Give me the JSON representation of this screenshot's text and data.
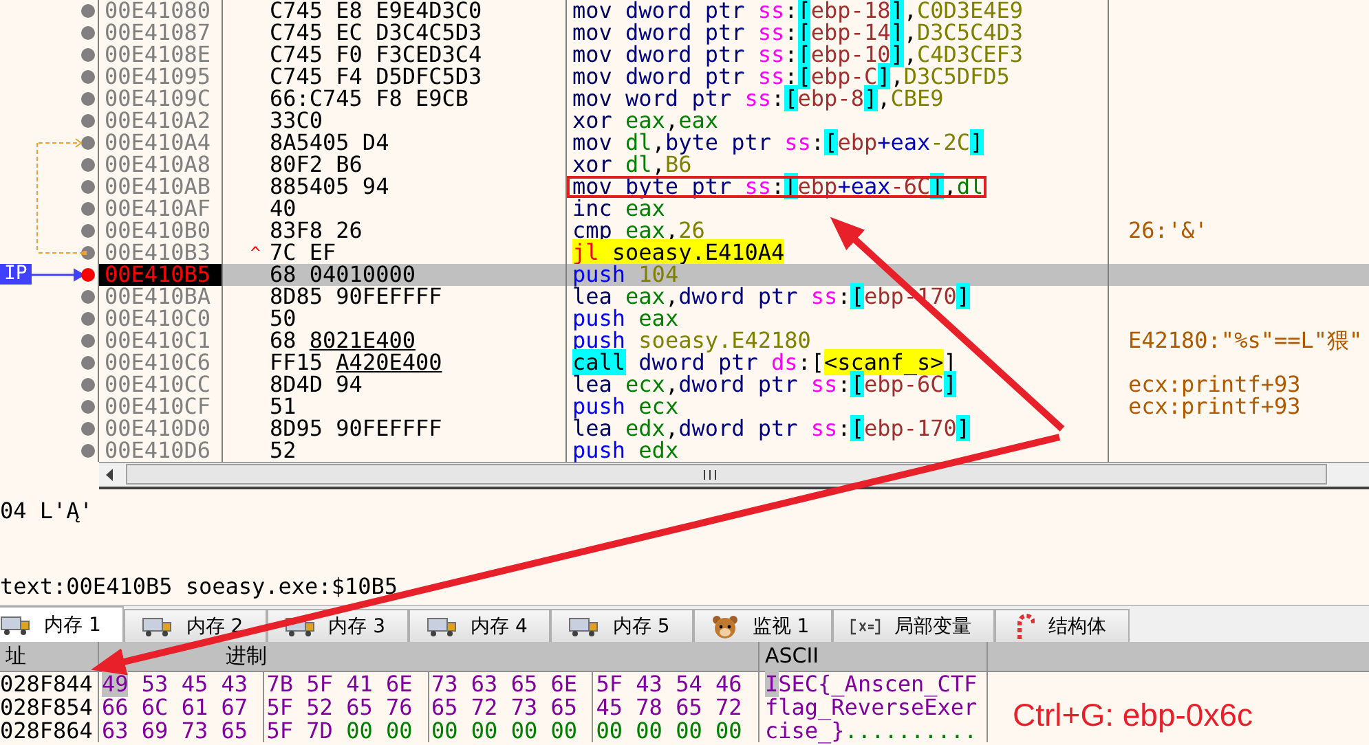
{
  "disassembly": {
    "rows": [
      {
        "address": "00E41080",
        "bytes": "C745 E8 E9E4D3C0",
        "selected": false,
        "boxed": false,
        "jump_target": false,
        "jump_source": false,
        "instruction": [
          {
            "kind": "mn",
            "text": "mov "
          },
          {
            "kind": "sz",
            "text": "dword ptr "
          },
          {
            "kind": "sg",
            "text": "ss"
          },
          {
            "kind": "p",
            "text": ":"
          },
          {
            "kind": "br",
            "text": "["
          },
          {
            "kind": "bp",
            "text": "ebp-18"
          },
          {
            "kind": "br",
            "text": "]"
          },
          {
            "kind": "p",
            "text": ","
          },
          {
            "kind": "nm",
            "text": "C0D3E4E9"
          }
        ]
      },
      {
        "address": "00E41087",
        "bytes": "C745 EC D3C4C5D3",
        "selected": false,
        "boxed": false,
        "jump_target": false,
        "jump_source": false,
        "instruction": [
          {
            "kind": "mn",
            "text": "mov "
          },
          {
            "kind": "sz",
            "text": "dword ptr "
          },
          {
            "kind": "sg",
            "text": "ss"
          },
          {
            "kind": "p",
            "text": ":"
          },
          {
            "kind": "br",
            "text": "["
          },
          {
            "kind": "bp",
            "text": "ebp-14"
          },
          {
            "kind": "br",
            "text": "]"
          },
          {
            "kind": "p",
            "text": ","
          },
          {
            "kind": "nm",
            "text": "D3C5C4D3"
          }
        ]
      },
      {
        "address": "00E4108E",
        "bytes": "C745 F0 F3CED3C4",
        "selected": false,
        "boxed": false,
        "jump_target": false,
        "jump_source": false,
        "instruction": [
          {
            "kind": "mn",
            "text": "mov "
          },
          {
            "kind": "sz",
            "text": "dword ptr "
          },
          {
            "kind": "sg",
            "text": "ss"
          },
          {
            "kind": "p",
            "text": ":"
          },
          {
            "kind": "br",
            "text": "["
          },
          {
            "kind": "bp",
            "text": "ebp-10"
          },
          {
            "kind": "br",
            "text": "]"
          },
          {
            "kind": "p",
            "text": ","
          },
          {
            "kind": "nm",
            "text": "C4D3CEF3"
          }
        ]
      },
      {
        "address": "00E41095",
        "bytes": "C745 F4 D5DFC5D3",
        "selected": false,
        "boxed": false,
        "jump_target": false,
        "jump_source": false,
        "instruction": [
          {
            "kind": "mn",
            "text": "mov "
          },
          {
            "kind": "sz",
            "text": "dword ptr "
          },
          {
            "kind": "sg",
            "text": "ss"
          },
          {
            "kind": "p",
            "text": ":"
          },
          {
            "kind": "br",
            "text": "["
          },
          {
            "kind": "bp",
            "text": "ebp-C"
          },
          {
            "kind": "br",
            "text": "]"
          },
          {
            "kind": "p",
            "text": ","
          },
          {
            "kind": "nm",
            "text": "D3C5DFD5"
          }
        ]
      },
      {
        "address": "00E4109C",
        "bytes": "66:C745 F8 E9CB",
        "selected": false,
        "boxed": false,
        "jump_target": false,
        "jump_source": false,
        "instruction": [
          {
            "kind": "mn",
            "text": "mov "
          },
          {
            "kind": "sz",
            "text": "word ptr "
          },
          {
            "kind": "sg",
            "text": "ss"
          },
          {
            "kind": "p",
            "text": ":"
          },
          {
            "kind": "br",
            "text": "["
          },
          {
            "kind": "bp",
            "text": "ebp-8"
          },
          {
            "kind": "br",
            "text": "]"
          },
          {
            "kind": "p",
            "text": ","
          },
          {
            "kind": "nm",
            "text": "CBE9"
          }
        ]
      },
      {
        "address": "00E410A2",
        "bytes": "33C0",
        "selected": false,
        "boxed": false,
        "jump_target": false,
        "jump_source": false,
        "instruction": [
          {
            "kind": "mn",
            "text": "xor "
          },
          {
            "kind": "rg",
            "text": "eax"
          },
          {
            "kind": "p",
            "text": ","
          },
          {
            "kind": "rg",
            "text": "eax"
          }
        ]
      },
      {
        "address": "00E410A4",
        "bytes": "8A5405 D4",
        "selected": false,
        "boxed": false,
        "jump_target": true,
        "jump_source": false,
        "instruction": [
          {
            "kind": "mn",
            "text": "mov "
          },
          {
            "kind": "rg",
            "text": "dl"
          },
          {
            "kind": "p",
            "text": ","
          },
          {
            "kind": "sz",
            "text": "byte ptr "
          },
          {
            "kind": "sg",
            "text": "ss"
          },
          {
            "kind": "p",
            "text": ":"
          },
          {
            "kind": "br",
            "text": "["
          },
          {
            "kind": "bp",
            "text": "ebp"
          },
          {
            "kind": "ix",
            "text": "+eax"
          },
          {
            "kind": "nm",
            "text": "-2C"
          },
          {
            "kind": "br",
            "text": "]"
          }
        ]
      },
      {
        "address": "00E410A8",
        "bytes": "80F2 B6",
        "selected": false,
        "boxed": false,
        "jump_target": false,
        "jump_source": false,
        "instruction": [
          {
            "kind": "mn",
            "text": "xor "
          },
          {
            "kind": "rg",
            "text": "dl"
          },
          {
            "kind": "p",
            "text": ","
          },
          {
            "kind": "nm",
            "text": "B6"
          }
        ]
      },
      {
        "address": "00E410AB",
        "bytes": "885405 94",
        "selected": false,
        "boxed": true,
        "jump_target": false,
        "jump_source": false,
        "instruction": [
          {
            "kind": "mn",
            "text": "mov "
          },
          {
            "kind": "sz",
            "text": "byte ptr "
          },
          {
            "kind": "sg",
            "text": "ss"
          },
          {
            "kind": "p",
            "text": ":"
          },
          {
            "kind": "br",
            "text": "["
          },
          {
            "kind": "bp",
            "text": "ebp"
          },
          {
            "kind": "ix",
            "text": "+eax"
          },
          {
            "kind": "bp",
            "text": "-6C"
          },
          {
            "kind": "br",
            "text": "]"
          },
          {
            "kind": "p",
            "text": ","
          },
          {
            "kind": "rg",
            "text": "dl"
          }
        ]
      },
      {
        "address": "00E410AF",
        "bytes": "40",
        "selected": false,
        "boxed": false,
        "jump_target": false,
        "jump_source": false,
        "instruction": [
          {
            "kind": "mn",
            "text": "inc "
          },
          {
            "kind": "rg",
            "text": "eax"
          }
        ]
      },
      {
        "address": "00E410B0",
        "bytes": "83F8 26",
        "selected": false,
        "boxed": false,
        "jump_target": false,
        "jump_source": false,
        "comment": "26:'&'",
        "instruction": [
          {
            "kind": "mn",
            "text": "cmp "
          },
          {
            "kind": "rg",
            "text": "eax"
          },
          {
            "kind": "p",
            "text": ","
          },
          {
            "kind": "nm",
            "text": "26"
          }
        ]
      },
      {
        "address": "00E410B3",
        "bytes": "7C EF",
        "jump_mark": "^",
        "selected": false,
        "boxed": false,
        "jump_target": false,
        "jump_source": true,
        "instruction": [
          {
            "kind": "jl",
            "text": "jl"
          },
          {
            "kind": "lb",
            "text": " soeasy.E410A4"
          }
        ]
      },
      {
        "address": "00E410B5",
        "bytes": "68 04010000",
        "ip_label": "IP",
        "selected": true,
        "boxed": false,
        "jump_target": false,
        "jump_source": false,
        "instruction": [
          {
            "kind": "ps",
            "text": "push "
          },
          {
            "kind": "nm",
            "text": "104"
          }
        ]
      },
      {
        "address": "00E410BA",
        "bytes": "8D85 90FEFFFF",
        "selected": false,
        "boxed": false,
        "jump_target": false,
        "jump_source": false,
        "instruction": [
          {
            "kind": "mn",
            "text": "lea "
          },
          {
            "kind": "rg",
            "text": "eax"
          },
          {
            "kind": "p",
            "text": ","
          },
          {
            "kind": "sz",
            "text": "dword ptr "
          },
          {
            "kind": "sg",
            "text": "ss"
          },
          {
            "kind": "p",
            "text": ":"
          },
          {
            "kind": "br",
            "text": "["
          },
          {
            "kind": "bp",
            "text": "ebp-170"
          },
          {
            "kind": "br",
            "text": "]"
          }
        ]
      },
      {
        "address": "00E410C0",
        "bytes": "50",
        "selected": false,
        "boxed": false,
        "jump_target": false,
        "jump_source": false,
        "instruction": [
          {
            "kind": "ps",
            "text": "push "
          },
          {
            "kind": "rg",
            "text": "eax"
          }
        ]
      },
      {
        "address": "00E410C1",
        "bytes": "68",
        "bytes_ref": "8021E400",
        "selected": false,
        "boxed": false,
        "jump_target": false,
        "jump_source": false,
        "comment": "E42180:\"%s\"==L\"猥\"",
        "instruction": [
          {
            "kind": "ps",
            "text": "push "
          },
          {
            "kind": "sy",
            "text": "soeasy.E42180"
          }
        ]
      },
      {
        "address": "00E410C6",
        "bytes": "FF15",
        "bytes_ref": "A420E400",
        "selected": false,
        "boxed": false,
        "jump_target": false,
        "jump_source": false,
        "instruction": [
          {
            "kind": "cl",
            "text": "call"
          },
          {
            "kind": "sz",
            "text": " dword ptr "
          },
          {
            "kind": "sg",
            "text": "ds"
          },
          {
            "kind": "p",
            "text": ":["
          },
          {
            "kind": "ap",
            "text": "<scanf_s>"
          },
          {
            "kind": "p",
            "text": "]"
          }
        ]
      },
      {
        "address": "00E410CC",
        "bytes": "8D4D 94",
        "selected": false,
        "boxed": false,
        "jump_target": false,
        "jump_source": false,
        "comment": "ecx:printf+93",
        "instruction": [
          {
            "kind": "mn",
            "text": "lea "
          },
          {
            "kind": "rg",
            "text": "ecx"
          },
          {
            "kind": "p",
            "text": ","
          },
          {
            "kind": "sz",
            "text": "dword ptr "
          },
          {
            "kind": "sg",
            "text": "ss"
          },
          {
            "kind": "p",
            "text": ":"
          },
          {
            "kind": "br",
            "text": "["
          },
          {
            "kind": "bp",
            "text": "ebp-6C"
          },
          {
            "kind": "br",
            "text": "]"
          }
        ]
      },
      {
        "address": "00E410CF",
        "bytes": "51",
        "selected": false,
        "boxed": false,
        "jump_target": false,
        "jump_source": false,
        "comment": "ecx:printf+93",
        "instruction": [
          {
            "kind": "ps",
            "text": "push "
          },
          {
            "kind": "rg",
            "text": "ecx"
          }
        ]
      },
      {
        "address": "00E410D0",
        "bytes": "8D95 90FEFFFF",
        "selected": false,
        "boxed": false,
        "jump_target": false,
        "jump_source": false,
        "instruction": [
          {
            "kind": "mn",
            "text": "lea "
          },
          {
            "kind": "rg",
            "text": "edx"
          },
          {
            "kind": "p",
            "text": ","
          },
          {
            "kind": "sz",
            "text": "dword ptr "
          },
          {
            "kind": "sg",
            "text": "ss"
          },
          {
            "kind": "p",
            "text": ":"
          },
          {
            "kind": "br",
            "text": "["
          },
          {
            "kind": "bp",
            "text": "ebp-170"
          },
          {
            "kind": "br",
            "text": "]"
          }
        ]
      },
      {
        "address": "00E410D6",
        "bytes": "52",
        "selected": false,
        "boxed": false,
        "jump_target": false,
        "jump_source": false,
        "instruction": [
          {
            "kind": "ps",
            "text": "push "
          },
          {
            "kind": "rg",
            "text": "edx"
          }
        ]
      }
    ]
  },
  "info_panel": {
    "lines": [
      "04 L'Ą'",
      "text:00E410B5 soeasy.exe:$10B5"
    ]
  },
  "tabs": [
    {
      "label": "内存 1",
      "kind": "memory",
      "selected": true
    },
    {
      "label": "内存 2",
      "kind": "memory",
      "selected": false
    },
    {
      "label": "内存 3",
      "kind": "memory",
      "selected": false
    },
    {
      "label": "内存 4",
      "kind": "memory",
      "selected": false
    },
    {
      "label": "内存 5",
      "kind": "memory",
      "selected": false
    },
    {
      "label": "监视 1",
      "kind": "watch",
      "selected": false
    },
    {
      "label": "局部变量",
      "kind": "locals",
      "selected": false
    },
    {
      "label": "结构体",
      "kind": "struct",
      "selected": false
    }
  ],
  "dump": {
    "columns": [
      "址",
      "进制",
      "ASCII"
    ],
    "rows": [
      {
        "address": "028F844",
        "cursor_on_first": true,
        "bytes": [
          "49",
          "53",
          "45",
          "43",
          "7B",
          "5F",
          "41",
          "6E",
          "73",
          "63",
          "65",
          "6E",
          "5F",
          "43",
          "54",
          "46"
        ],
        "ascii": "ISEC{_Anscen_CTF"
      },
      {
        "address": "028F854",
        "cursor_on_first": false,
        "bytes": [
          "66",
          "6C",
          "61",
          "67",
          "5F",
          "52",
          "65",
          "76",
          "65",
          "72",
          "73",
          "65",
          "45",
          "78",
          "65",
          "72"
        ],
        "ascii": "flag_ReverseExer"
      },
      {
        "address": "028F864",
        "cursor_on_first": false,
        "bytes": [
          "63",
          "69",
          "73",
          "65",
          "5F",
          "7D",
          "00",
          "00",
          "00",
          "00",
          "00",
          "00",
          "00",
          "00",
          "00",
          "00"
        ],
        "ascii": "cise_}",
        "ascii_null": ".........."
      }
    ]
  },
  "annotation": {
    "text": "Ctrl+G: ebp-0x6c"
  }
}
